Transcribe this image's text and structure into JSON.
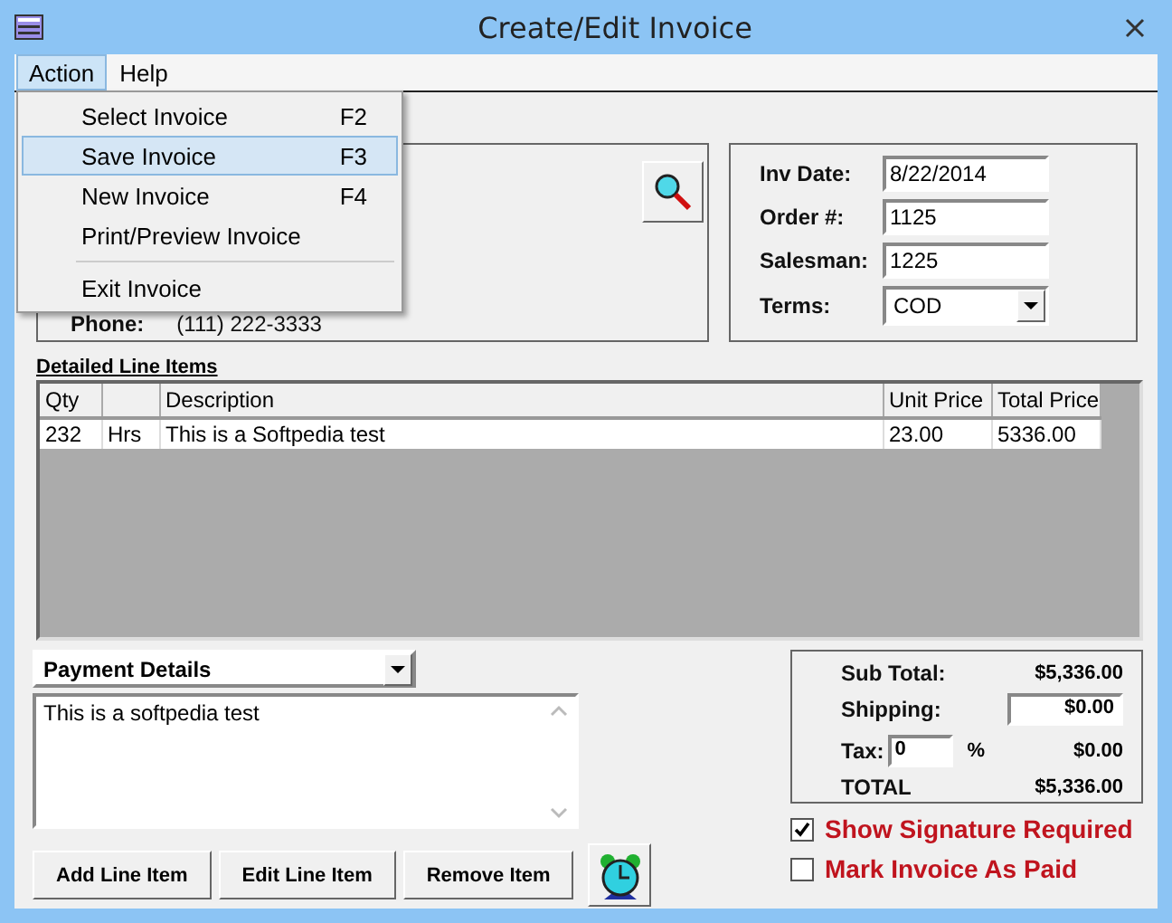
{
  "window": {
    "title": "Create/Edit Invoice"
  },
  "menu_bar": [
    {
      "label": "Action",
      "selected": true
    },
    {
      "label": "Help",
      "selected": false
    }
  ],
  "action_menu": [
    {
      "kind": "item",
      "label": "Select Invoice",
      "shortcut": "F2",
      "selected": false
    },
    {
      "kind": "item",
      "label": "Save Invoice",
      "shortcut": "F3",
      "selected": true
    },
    {
      "kind": "item",
      "label": "New Invoice",
      "shortcut": "F4",
      "selected": false
    },
    {
      "kind": "item",
      "label": "Print/Preview Invoice",
      "selected": false
    },
    {
      "kind": "separator"
    },
    {
      "kind": "item",
      "label": "Exit Invoice",
      "selected": false
    }
  ],
  "customer": {
    "phone_label": "Phone:",
    "phone": "(111) 222-3333"
  },
  "invoice_info": [
    {
      "kind": "text",
      "label": "Inv Date:",
      "value": "8/22/2014"
    },
    {
      "kind": "text",
      "label": "Order #:",
      "value": "1125"
    },
    {
      "kind": "text",
      "label": "Salesman:",
      "value": "1225"
    },
    {
      "kind": "select",
      "label": "Terms:",
      "value": "COD"
    }
  ],
  "line_items": {
    "title": "Detailed Line Items",
    "columns": [
      {
        "kind": "labeled",
        "label": "Qty"
      },
      {
        "kind": "blank"
      },
      {
        "kind": "labeled",
        "label": "Description"
      },
      {
        "kind": "labeled",
        "label": "Unit Price"
      },
      {
        "kind": "labeled",
        "label": "Total Price"
      }
    ],
    "rows": [
      {
        "cells": [
          "232",
          "Hrs",
          "This is a Softpedia test",
          "23.00",
          "5336.00"
        ]
      }
    ]
  },
  "payment": {
    "selector": "Payment Details",
    "notes": "This is a softpedia test"
  },
  "buttons": [
    "Add Line Item",
    "Edit Line Item",
    "Remove Item"
  ],
  "totals": {
    "sub_total_label": "Sub Total:",
    "sub_total": "$5,336.00",
    "shipping_label": "Shipping:",
    "shipping": "$0.00",
    "tax_label": "Tax:",
    "tax_rate": "0",
    "percent": "%",
    "tax": "$0.00",
    "total_label": "TOTAL",
    "total": "$5,336.00"
  },
  "options": [
    {
      "label": "Show Signature Required",
      "checked": true
    },
    {
      "label": "Mark Invoice As Paid",
      "checked": false
    }
  ]
}
